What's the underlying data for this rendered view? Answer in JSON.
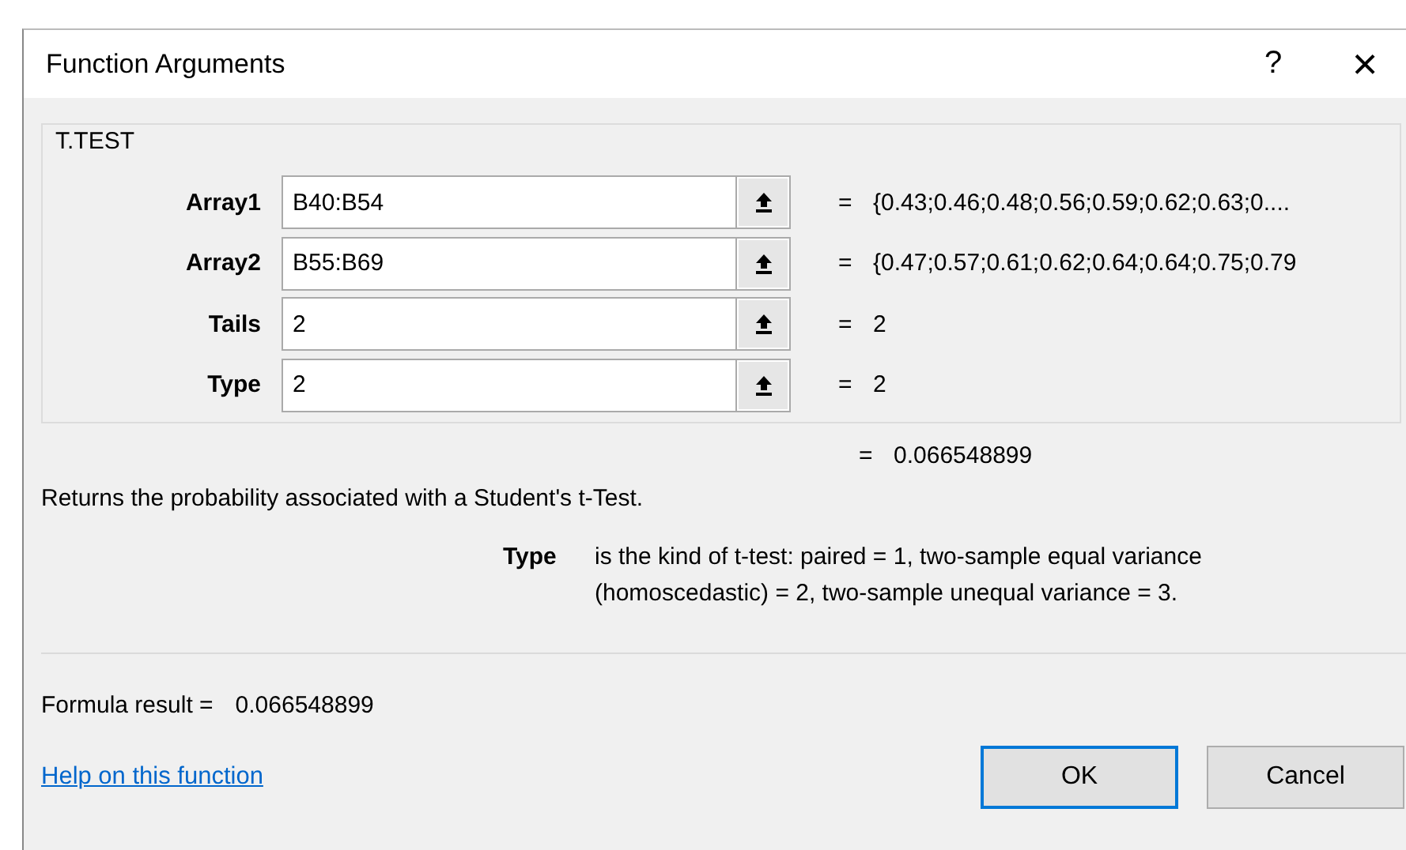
{
  "window": {
    "title": "Function Arguments",
    "help_button": "?",
    "close_button": "×"
  },
  "function_name": "T.TEST",
  "arguments": [
    {
      "label": "Array1",
      "value": "B40:B54",
      "equals": "=",
      "result": "{0.43;0.46;0.48;0.56;0.59;0.62;0.63;0...."
    },
    {
      "label": "Array2",
      "value": "B55:B69",
      "equals": "=",
      "result": "{0.47;0.57;0.61;0.62;0.64;0.64;0.75;0.79"
    },
    {
      "label": "Tails",
      "value": "2",
      "equals": "=",
      "result": "2"
    },
    {
      "label": "Type",
      "value": "2",
      "equals": "=",
      "result": "2"
    }
  ],
  "overall_result": {
    "equals": "=",
    "value": "0.066548899"
  },
  "description": "Returns the probability associated with a Student's t-Test.",
  "argument_help": {
    "name": "Type",
    "text": "is the kind of t-test: paired = 1, two-sample equal variance (homoscedastic) = 2, two-sample unequal variance = 3."
  },
  "formula_result": {
    "label": "Formula result =",
    "value": "0.066548899"
  },
  "help_link": "Help on this function",
  "buttons": [
    {
      "label": "OK",
      "default": true
    },
    {
      "label": "Cancel",
      "default": false
    }
  ]
}
